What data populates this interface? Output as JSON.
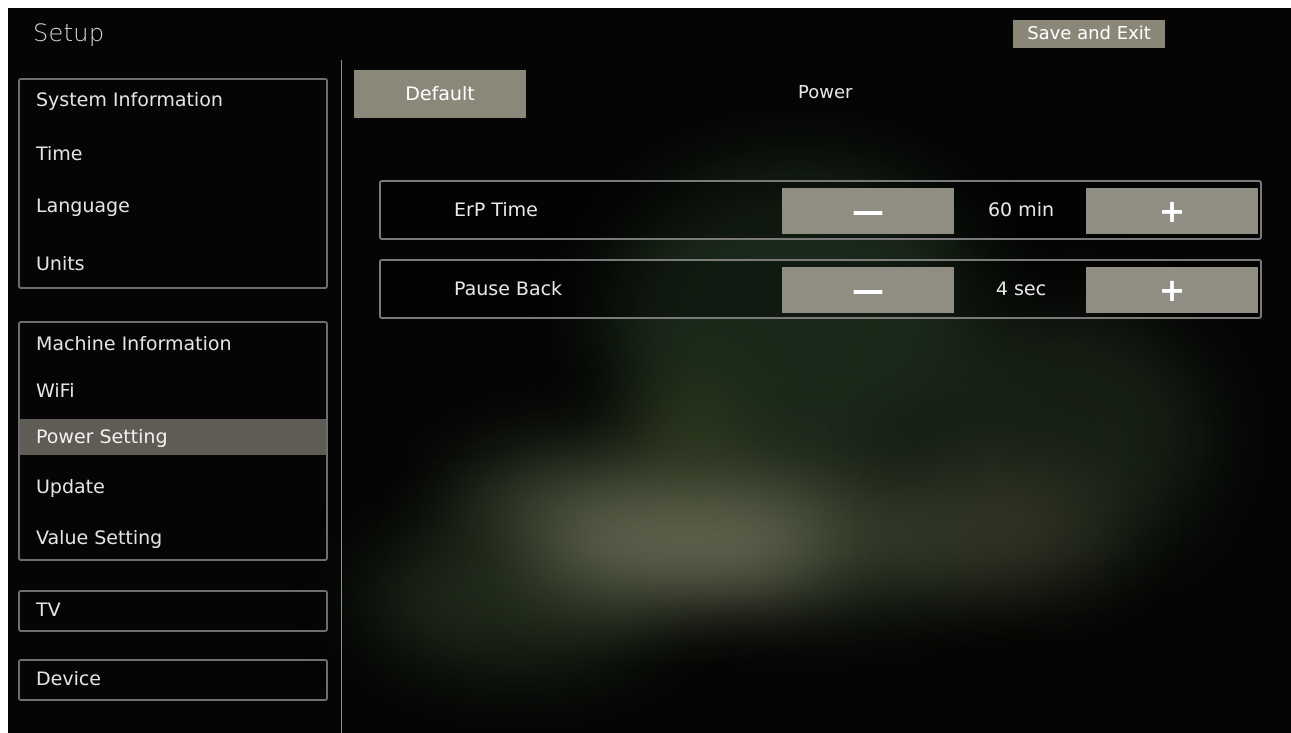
{
  "header": {
    "title": "Setup",
    "save_exit_label": "Save and Exit"
  },
  "sidebar": {
    "groups": [
      {
        "items": [
          {
            "label": "System Information",
            "active": false
          },
          {
            "label": "Time",
            "active": false
          },
          {
            "label": "Language",
            "active": false
          },
          {
            "label": "Units",
            "active": false
          }
        ]
      },
      {
        "items": [
          {
            "label": "Machine Information",
            "active": false
          },
          {
            "label": "WiFi",
            "active": false
          },
          {
            "label": "Power Setting",
            "active": true
          },
          {
            "label": "Update",
            "active": false
          },
          {
            "label": "Value Setting",
            "active": false
          }
        ]
      },
      {
        "items": [
          {
            "label": "TV",
            "active": false
          }
        ]
      },
      {
        "items": [
          {
            "label": "Device",
            "active": false
          }
        ]
      }
    ]
  },
  "main": {
    "default_label": "Default",
    "section_title": "Power",
    "settings": [
      {
        "label": "ErP Time",
        "value": "60 min",
        "decrement_icon": "minus-icon",
        "increment_icon": "plus-icon",
        "decrement_glyph": "—",
        "increment_glyph": "+"
      },
      {
        "label": "Pause Back",
        "value": "4 sec",
        "decrement_icon": "minus-icon",
        "increment_icon": "plus-icon",
        "decrement_glyph": "—",
        "increment_glyph": "+"
      }
    ]
  },
  "colors": {
    "background": "#040504",
    "button": "#8b8779",
    "active_item": "#5e5c54",
    "border": "#7a7a7a"
  }
}
